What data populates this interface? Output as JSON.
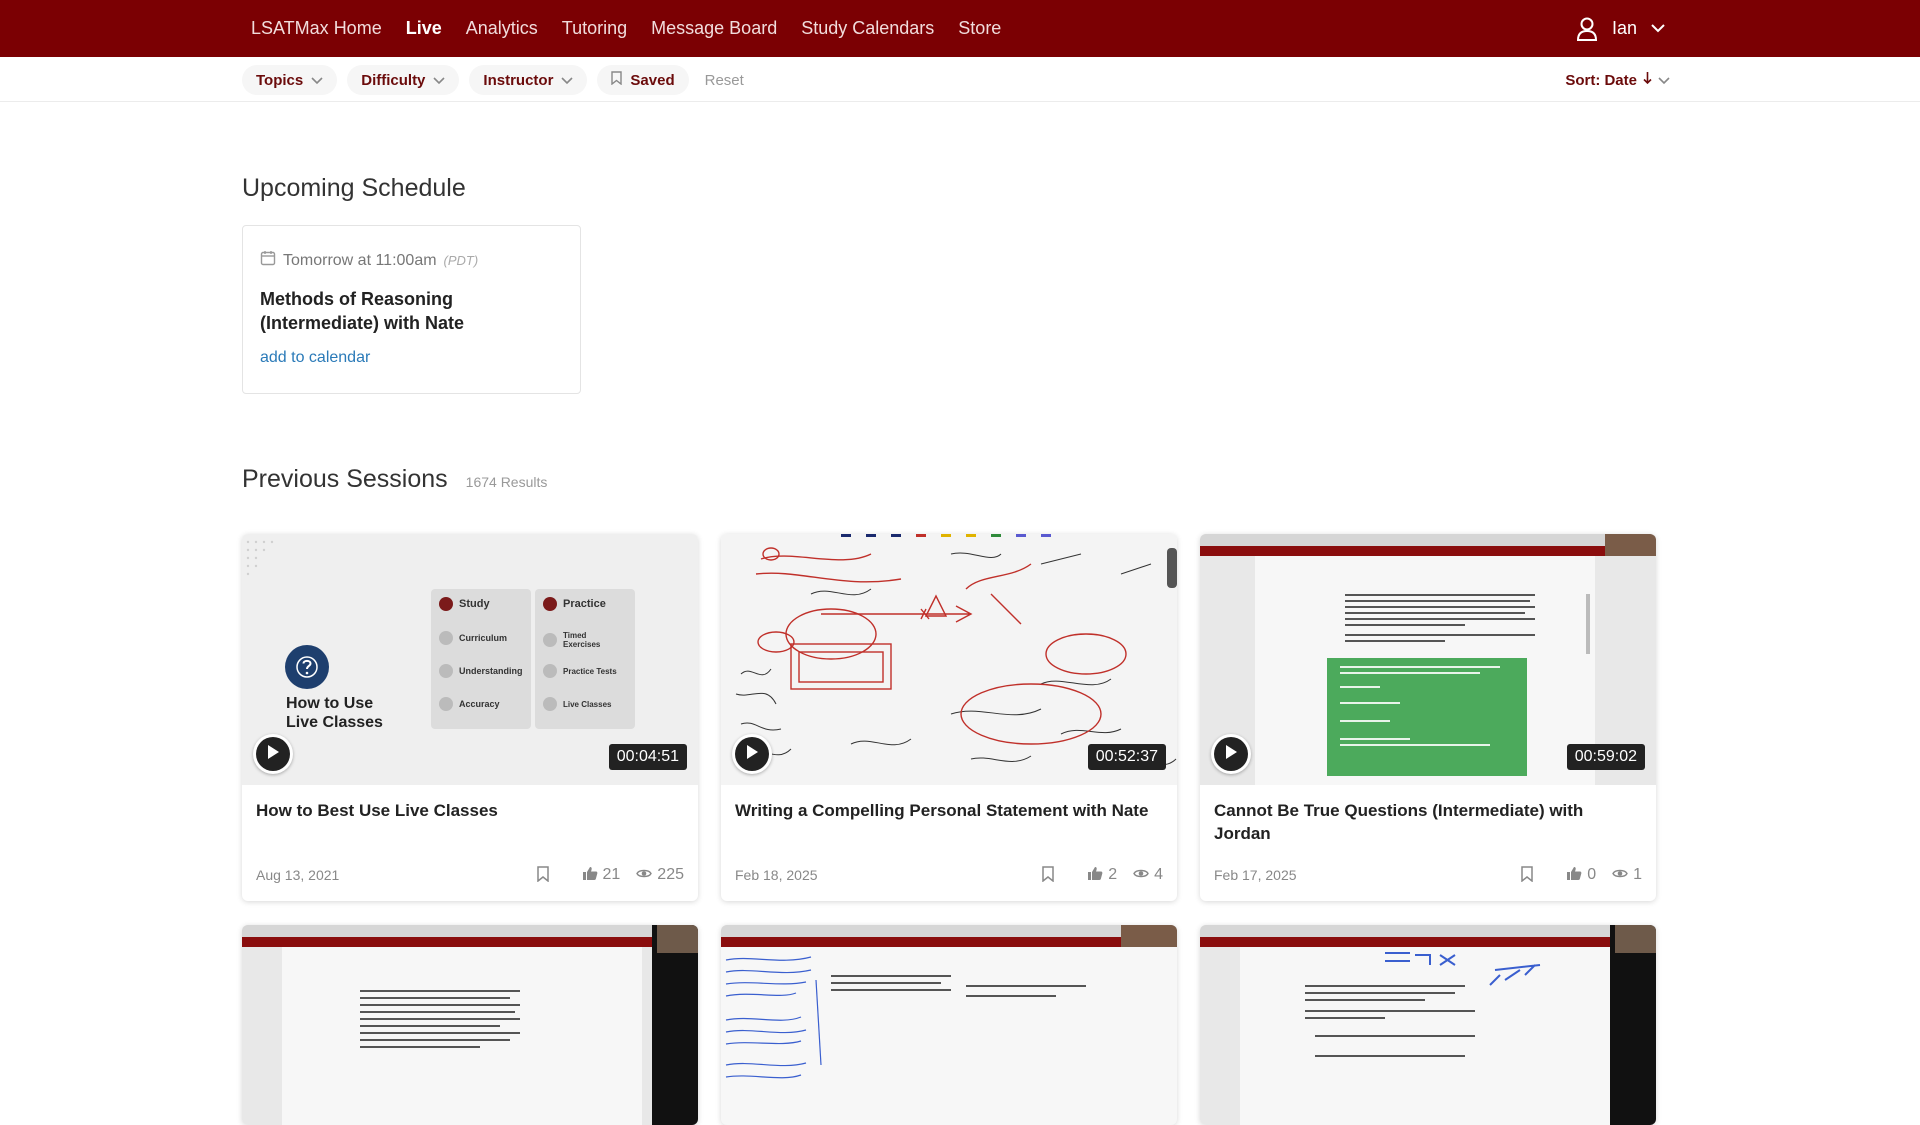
{
  "nav": {
    "links": [
      "LSATMax Home",
      "Live",
      "Analytics",
      "Tutoring",
      "Message Board",
      "Study Calendars",
      "Store"
    ],
    "active": "Live",
    "user_name": "Ian"
  },
  "filters": {
    "topics": "Topics",
    "difficulty": "Difficulty",
    "instructor": "Instructor",
    "saved": "Saved",
    "reset": "Reset",
    "sort": "Sort: Date"
  },
  "schedule": {
    "heading": "Upcoming Schedule",
    "when": "Tomorrow at 11:00am",
    "timezone": "(PDT)",
    "name": "Methods of Reasoning (Intermediate) with Nate",
    "add_link": "add to calendar"
  },
  "previous": {
    "heading": "Previous Sessions",
    "count": "1674 Results",
    "cards": [
      {
        "title": "How to Best Use Live Classes",
        "duration": "00:04:51",
        "date": "Aug 13, 2021",
        "likes": "21",
        "views": "225",
        "thumb": {
          "headline_1": "How to Use",
          "headline_2": "Live Classes",
          "study": "Study",
          "curriculum": "Curriculum",
          "understanding": "Understanding",
          "accuracy": "Accuracy",
          "practice": "Practice",
          "timed": "Timed Exercises",
          "tests": "Practice Tests",
          "live": "Live Classes"
        }
      },
      {
        "title": "Writing a Compelling Personal Statement with Nate",
        "duration": "00:52:37",
        "date": "Feb 18, 2025",
        "likes": "2",
        "views": "4"
      },
      {
        "title": "Cannot Be True Questions (Intermediate) with Jordan",
        "duration": "00:59:02",
        "date": "Feb 17, 2025",
        "likes": "0",
        "views": "1"
      }
    ]
  },
  "colors": {
    "brand": "#7b0003",
    "link": "#2a7ab8"
  }
}
